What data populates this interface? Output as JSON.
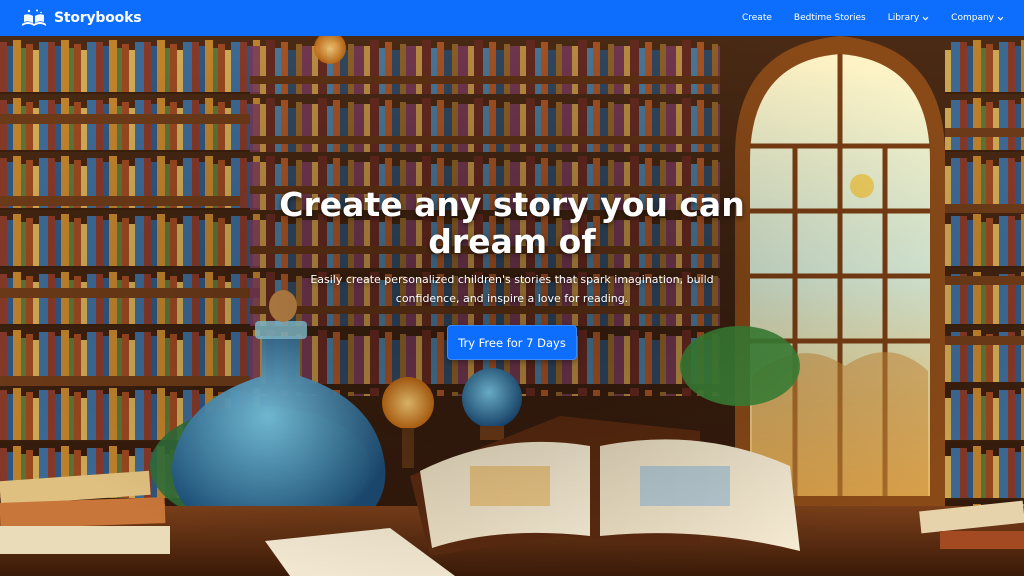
{
  "nav": {
    "brand": "Storybooks",
    "links": [
      {
        "label": "Create"
      },
      {
        "label": "Bedtime Stories"
      },
      {
        "label": "Library"
      },
      {
        "label": "Company"
      }
    ]
  },
  "hero": {
    "title": "Create any story you can dream of",
    "subtitle": "Easily create personalized children's stories that spark imagination, build confidence, and inspire a love for reading.",
    "cta": "Try Free for 7 Days"
  },
  "colors": {
    "primary": "#0d6efd",
    "white": "#ffffff"
  },
  "icons": {
    "brand": "book-logo-icon",
    "dropdown": "chevron-down-icon"
  }
}
